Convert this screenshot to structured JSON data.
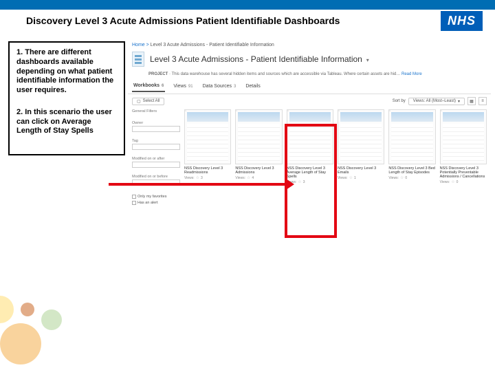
{
  "slide_title": "Discovery Level 3 Acute Admissions Patient Identifiable Dashboards",
  "nhs_logo": "NHS",
  "callout": {
    "p1": "1. There are different dashboards available depending on what patient identifiable information the user requires.",
    "p2": "2. In this scenario the user can click on Average Length of Stay Spells"
  },
  "breadcrumb": {
    "home": "Home",
    "sep": " > ",
    "current": "Level 3 Acute Admissions - Patient Identifiable Information"
  },
  "page": {
    "title": "Level 3 Acute Admissions - Patient Identifiable Information",
    "caret": "▾",
    "project_label": "PROJECT",
    "project_desc": "This data warehouse has several hidden items and sources which are accessible via Tableau. Where certain assets are hid…",
    "readmore": "Read More"
  },
  "tabs": {
    "workbooks": "Workbooks",
    "wb_count": "6",
    "views": "Views",
    "v_count": "91",
    "datasources": "Data Sources",
    "ds_count": "3",
    "details": "Details"
  },
  "filter": {
    "select_all": "Select All",
    "sort_label": "Sort by",
    "sort_value": "Views: All (Most–Least)",
    "caret": "▾"
  },
  "sidebar": {
    "general": "General Filters",
    "owner": "Owner",
    "tag": "Tag",
    "modified_label": "Modified on or after",
    "modified_before": "Modified on or before",
    "only_fav": "Only my favorites",
    "has_alert": "Has an alert"
  },
  "workbooks": [
    {
      "name": "NSS Discovery Level 3 Readmissions",
      "views_label": "Views:",
      "views": "3"
    },
    {
      "name": "NSS Discovery Level 3 Admissions",
      "views_label": "Views:",
      "views": "4"
    },
    {
      "name": "NSS Discovery Level 3 Average Length of Stay Spells",
      "views_label": "Views:",
      "views": "3"
    },
    {
      "name": "NSS Discovery Level 3 Emails",
      "views_label": "Views:",
      "views": "1"
    },
    {
      "name": "NSS Discovery Level 3 Bed Length of Stay Episodes",
      "views_label": "Views:",
      "views": "0"
    },
    {
      "name": "NSS Discovery Level 3 Potentially Preventable Admissions / Cancellations",
      "views_label": "Views:",
      "views": "0"
    }
  ]
}
